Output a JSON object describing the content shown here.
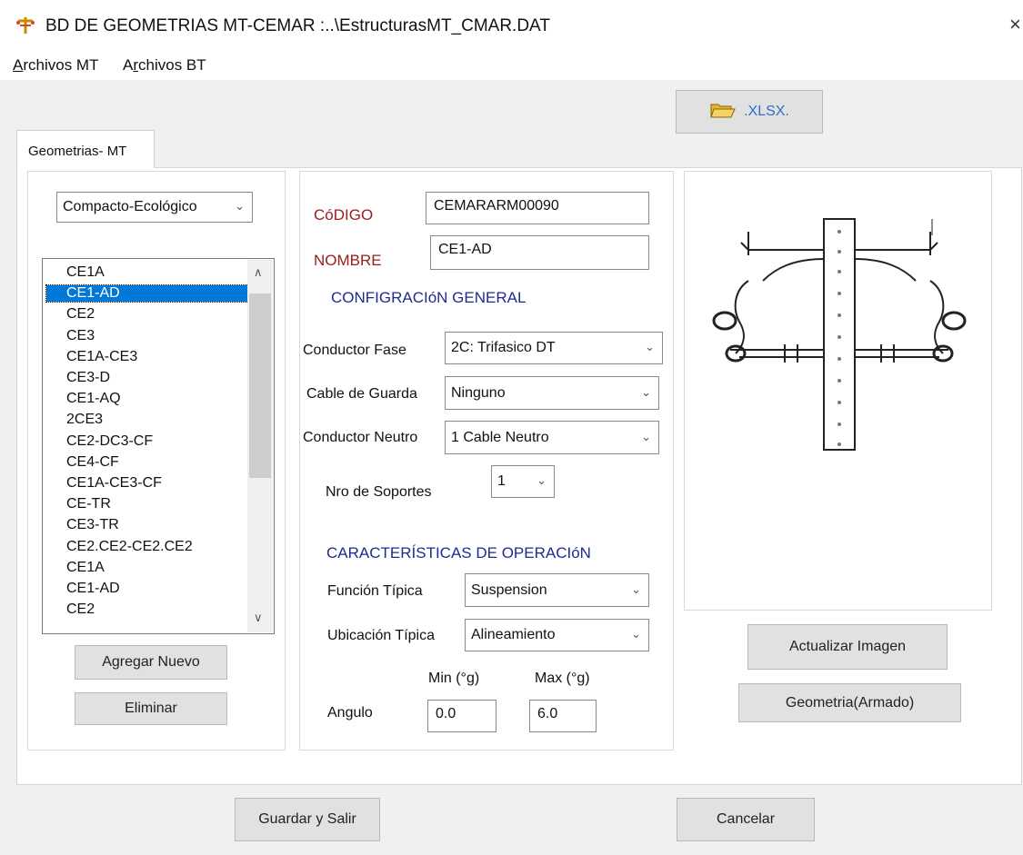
{
  "window": {
    "title": "BD DE GEOMETRIAS MT-CEMAR :..\\EstructurasMT_CMAR.DAT",
    "close_glyph": "×"
  },
  "menu": [
    {
      "accel": "A",
      "rest": "rchivos MT"
    },
    {
      "pre": "A",
      "accel": "r",
      "rest": "chivos BT"
    }
  ],
  "xlsx_button": {
    "label": ".XLSX.",
    "icon": "open-folder-icon"
  },
  "tab": {
    "label": "Geometrias- MT"
  },
  "category_select": {
    "value": "Compacto-Ecológico"
  },
  "structure_list": {
    "items": [
      "CE1A",
      "CE1-AD",
      "CE2",
      "CE3",
      "CE1A-CE3",
      "CE3-D",
      "CE1-AQ",
      "2CE3",
      "CE2-DC3-CF",
      "CE4-CF",
      "CE1A-CE3-CF",
      "CE-TR",
      "CE3-TR",
      "CE2.CE2-CE2.CE2",
      "CE1A",
      "CE1-AD",
      "CE2"
    ],
    "selected_index": 1
  },
  "buttons": {
    "add_new": "Agregar Nuevo",
    "delete": "Eliminar",
    "update_image": "Actualizar Imagen",
    "geometry": "Geometria(Armado)",
    "save_exit": "Guardar y Salir",
    "cancel": "Cancelar"
  },
  "form": {
    "code_label": "CóDIGO",
    "code_value": "CEMARARM00090",
    "name_label": "NOMBRE",
    "name_value": "CE1-AD",
    "general_config_title": "CONFIGRACIóN GENERAL",
    "phase_conductor_label": "Conductor Fase",
    "phase_conductor_value": "2C: Trifasico DT",
    "guard_cable_label": "Cable de Guarda",
    "guard_cable_value": "Ninguno",
    "neutral_conductor_label": "Conductor Neutro",
    "neutral_conductor_value": "1 Cable Neutro",
    "supports_label": "Nro de Soportes",
    "supports_value": "1",
    "operation_title": "CARACTERÍSTICAS DE OPERACIóN",
    "function_label": "Función Típica",
    "function_value": "Suspension",
    "location_label": "Ubicación Típica",
    "location_value": "Alineamiento",
    "min_label": "Min (°g)",
    "max_label": "Max (°g)",
    "angle_label": "Angulo",
    "angle_min": "0.0",
    "angle_max": "6.0"
  },
  "colors": {
    "selection": "#0078d7",
    "red_label": "#9b1c1c",
    "blue_label": "#1f2b8f"
  }
}
